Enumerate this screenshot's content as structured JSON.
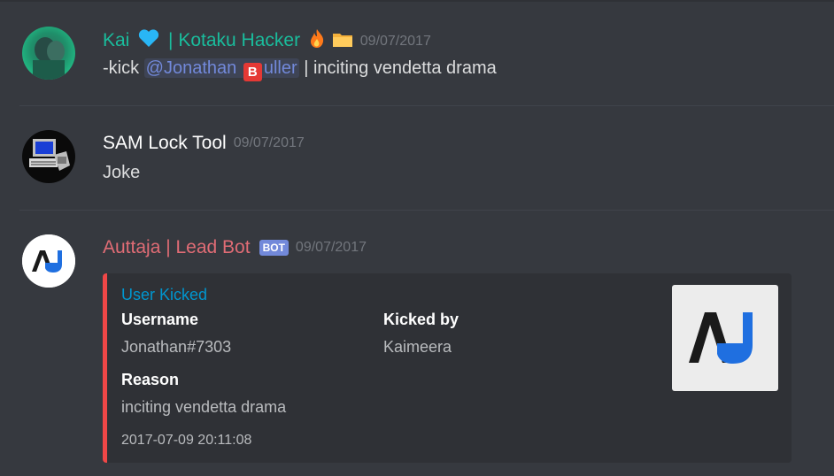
{
  "messages": [
    {
      "author": "Kai",
      "author_suffix": "| Kotaku Hacker",
      "author_color": "#1abc9c",
      "timestamp": "09/07/2017",
      "content_prefix": "-kick ",
      "mention_start": "@Jonathan",
      "mention_emoji": "B",
      "mention_end": "uller",
      "content_suffix": " | inciting vendetta drama"
    },
    {
      "author": "SAM Lock Tool",
      "author_color": "#ffffff",
      "timestamp": "09/07/2017",
      "content": "Joke"
    },
    {
      "author": "Auttaja | Lead Bot",
      "author_color": "#e06c75",
      "bot_tag": "BOT",
      "timestamp": "09/07/2017",
      "embed": {
        "title": "User Kicked",
        "color": "#f04747",
        "fields": [
          {
            "name": "Username",
            "value": "Jonathan#7303"
          },
          {
            "name": "Kicked by",
            "value": "Kaimeera"
          },
          {
            "name": "Reason",
            "value": "inciting vendetta drama"
          }
        ],
        "footer": "2017-07-09 20:11:08",
        "thumbnail_logo": "AU"
      }
    }
  ],
  "icons": {
    "heart": "blue-heart-icon",
    "fire": "fire-icon",
    "folder": "folder-icon"
  },
  "colors": {
    "background": "#36393f",
    "mention": "#7289da",
    "link": "#0096cf",
    "timestamp": "#72767d"
  }
}
